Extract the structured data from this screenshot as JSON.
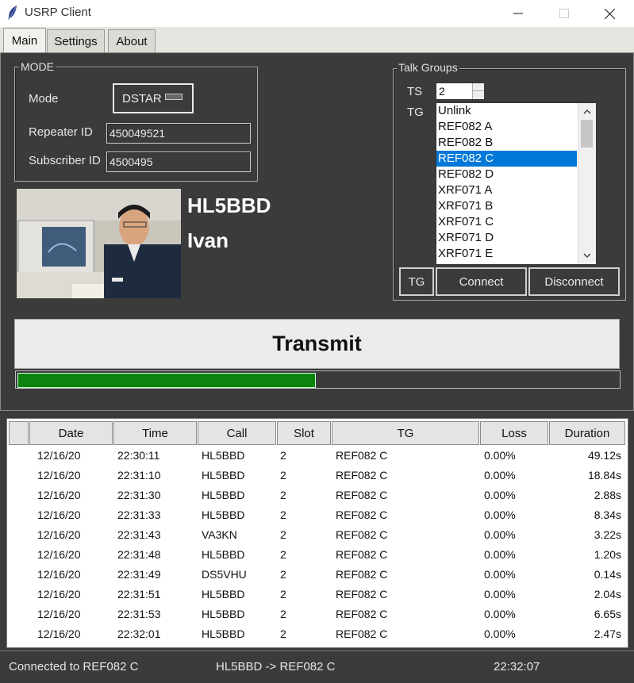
{
  "window": {
    "title": "USRP Client",
    "icon": "feather-icon"
  },
  "tabs": [
    {
      "label": "Main",
      "active": true
    },
    {
      "label": "Settings",
      "active": false
    },
    {
      "label": "About",
      "active": false
    }
  ],
  "mode_group": {
    "legend": "MODE",
    "mode_label": "Mode",
    "mode_value": "DSTAR",
    "repeater_label": "Repeater ID",
    "repeater_value": "450049521",
    "subscriber_label": "Subscriber ID",
    "subscriber_value": "4500495"
  },
  "profile": {
    "callsign": "HL5BBD",
    "name": "Ivan"
  },
  "talk_groups": {
    "legend": "Talk Groups",
    "ts_label": "TS",
    "ts_value": "2",
    "tg_label": "TG",
    "items": [
      "Unlink",
      "REF082 A",
      "REF082 B",
      "REF082 C",
      "REF082 D",
      "XRF071 A",
      "XRF071 B",
      "XRF071 C",
      "XRF071 D",
      "XRF071 E"
    ],
    "selected_index": 3,
    "tg_button": "TG",
    "connect_button": "Connect",
    "disconnect_button": "Disconnect"
  },
  "transmit": {
    "label": "Transmit",
    "level": 0.495
  },
  "log_table": {
    "columns": [
      "Date",
      "Time",
      "Call",
      "Slot",
      "TG",
      "Loss",
      "Duration"
    ],
    "rows": [
      [
        "12/16/20",
        "22:30:11",
        "HL5BBD",
        "2",
        "REF082 C",
        "0.00%",
        "49.12s"
      ],
      [
        "12/16/20",
        "22:31:10",
        "HL5BBD",
        "2",
        "REF082 C",
        "0.00%",
        "18.84s"
      ],
      [
        "12/16/20",
        "22:31:30",
        "HL5BBD",
        "2",
        "REF082 C",
        "0.00%",
        "2.88s"
      ],
      [
        "12/16/20",
        "22:31:33",
        "HL5BBD",
        "2",
        "REF082 C",
        "0.00%",
        "8.34s"
      ],
      [
        "12/16/20",
        "22:31:43",
        "VA3KN",
        "2",
        "REF082 C",
        "0.00%",
        "3.22s"
      ],
      [
        "12/16/20",
        "22:31:48",
        "HL5BBD",
        "2",
        "REF082 C",
        "0.00%",
        "1.20s"
      ],
      [
        "12/16/20",
        "22:31:49",
        "DS5VHU",
        "2",
        "REF082 C",
        "0.00%",
        "0.14s"
      ],
      [
        "12/16/20",
        "22:31:51",
        "HL5BBD",
        "2",
        "REF082 C",
        "0.00%",
        "2.04s"
      ],
      [
        "12/16/20",
        "22:31:53",
        "HL5BBD",
        "2",
        "REF082 C",
        "0.00%",
        "6.65s"
      ],
      [
        "12/16/20",
        "22:32:01",
        "HL5BBD",
        "2",
        "REF082 C",
        "0.00%",
        "2.47s"
      ]
    ]
  },
  "status": {
    "connection": "Connected to REF082 C",
    "activity": "HL5BBD -> REF082 C",
    "time": "22:32:07"
  },
  "colors": {
    "panel": "#3b3b3b",
    "progress": "#0c830c",
    "selection": "#0078d7"
  }
}
